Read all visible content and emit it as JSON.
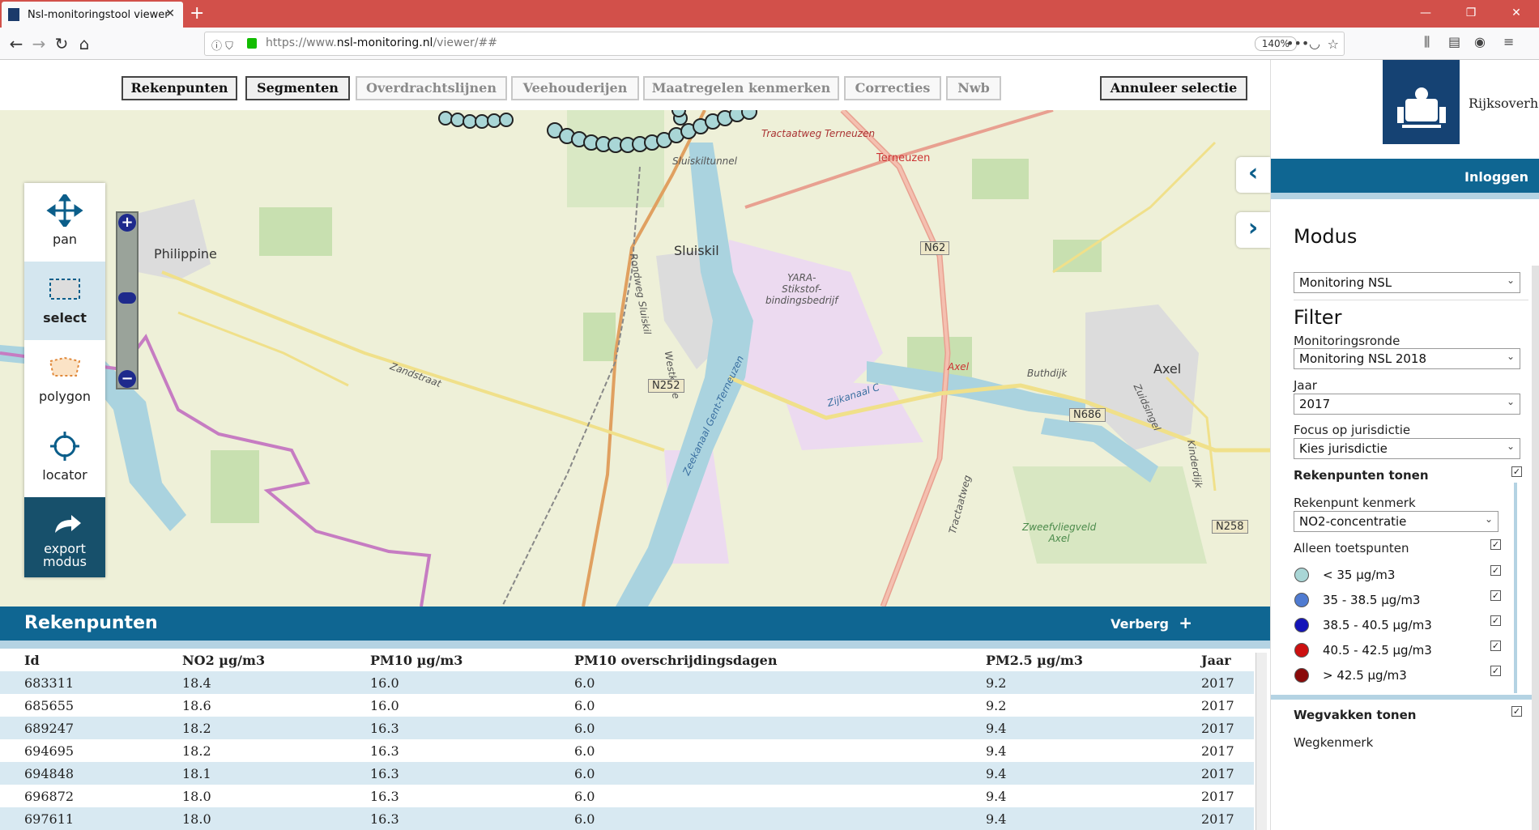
{
  "browser": {
    "tab_title": "Nsl-monitoringstool viewer",
    "tab_close": "✕",
    "new_tab": "+",
    "url_prefix": "https://www.",
    "url_domain": "nsl-monitoring.nl",
    "url_path": "/viewer/##",
    "zoom": "140%",
    "page_actions": "•••"
  },
  "toolbar_buttons": [
    {
      "label": "Rekenpunten",
      "enabled": true
    },
    {
      "label": "Segmenten",
      "enabled": true
    },
    {
      "label": "Overdrachtslijnen",
      "enabled": false
    },
    {
      "label": "Veehouderijen",
      "enabled": false
    },
    {
      "label": "Maatregelen kenmerken",
      "enabled": false
    },
    {
      "label": "Correcties",
      "enabled": false
    },
    {
      "label": "Nwb",
      "enabled": false
    }
  ],
  "cancel_selection": "Annuleer selectie",
  "tools": {
    "pan": "pan",
    "select": "select",
    "polygon": "polygon",
    "locator": "locator",
    "export": "export modus"
  },
  "zoom_controls": {
    "plus": "+",
    "minus": "−"
  },
  "map_labels": {
    "philippine": "Philippine",
    "sluiskil": "Sluiskil",
    "axel": "Axel",
    "terneuzen": "Terneuzen",
    "terneuzen_road": "Tractaatweg Terneuzen",
    "sluiskiltunnel": "Sluiskiltunnel",
    "yara": "YARA-\nStikstof-\nbindingsbedrijf",
    "zandstraat": "Zandstraat",
    "zeekanaal": "Zeekanaal Gent-Terneuzen",
    "zijkanaal": "Zijkanaal C",
    "westkade": "Westkade",
    "rondweg": "Rondweg Sluiskil",
    "tractaatweg": "Tractaatweg",
    "buthdijk": "Buthdijk",
    "zuidsingel": "Zuidsingel",
    "kinderdijk": "Kinderdijk",
    "zweefvliegveld": "Zweefvliegveld\nAxel",
    "axel_red": "Axel",
    "n62": "N62",
    "n252": "N252",
    "n686": "N686",
    "n258": "N258"
  },
  "panel": {
    "title": "Rekenpunten",
    "hide": "Verberg",
    "plus": "+",
    "columns": [
      "Id",
      "NO2 µg/m3",
      "PM10 µg/m3",
      "PM10 overschrijdingsdagen",
      "PM2.5 µg/m3",
      "Jaar"
    ],
    "rows": [
      [
        "683311",
        "18.4",
        "16.0",
        "6.0",
        "9.2",
        "2017"
      ],
      [
        "685655",
        "18.6",
        "16.0",
        "6.0",
        "9.2",
        "2017"
      ],
      [
        "689247",
        "18.2",
        "16.3",
        "6.0",
        "9.4",
        "2017"
      ],
      [
        "694695",
        "18.2",
        "16.3",
        "6.0",
        "9.4",
        "2017"
      ],
      [
        "694848",
        "18.1",
        "16.3",
        "6.0",
        "9.4",
        "2017"
      ],
      [
        "696872",
        "18.0",
        "16.3",
        "6.0",
        "9.4",
        "2017"
      ],
      [
        "697611",
        "18.0",
        "16.3",
        "6.0",
        "9.4",
        "2017"
      ]
    ]
  },
  "sidebar": {
    "logo_text": "Rijksoverheid",
    "login": "Inloggen",
    "modus_heading": "Modus",
    "modus_value": "Monitoring NSL",
    "filter_heading": "Filter",
    "ronde_label": "Monitoringsronde",
    "ronde_value": "Monitoring NSL 2018",
    "jaar_label": "Jaar",
    "jaar_value": "2017",
    "jurisdictie_label": "Focus op jurisdictie",
    "jurisdictie_value": "Kies jurisdictie",
    "rekenpunten_tonen": "Rekenpunten tonen",
    "kenmerk_label": "Rekenpunt kenmerk",
    "kenmerk_value": "NO2-concentratie",
    "toetspunten": "Alleen toetspunten",
    "legend": [
      {
        "label": "< 35 µg/m3",
        "color": "#a9d6d6"
      },
      {
        "label": "35 - 38.5 µg/m3",
        "color": "#4f7bd1"
      },
      {
        "label": "38.5 - 40.5 µg/m3",
        "color": "#1414b8"
      },
      {
        "label": "40.5 - 42.5 µg/m3",
        "color": "#cc1010"
      },
      {
        "label": "> 42.5 µg/m3",
        "color": "#8a0a0a"
      }
    ],
    "wegvakken_tonen": "Wegvakken tonen",
    "wegkenmerk": "Wegkenmerk",
    "check_mark": "✓",
    "select_chevron": "⌄"
  },
  "colors": {
    "accent": "#0f6692",
    "accent_light": "#b4d3e3",
    "row_alt": "#d8e9f2",
    "tab_bar": "#d2504a"
  }
}
